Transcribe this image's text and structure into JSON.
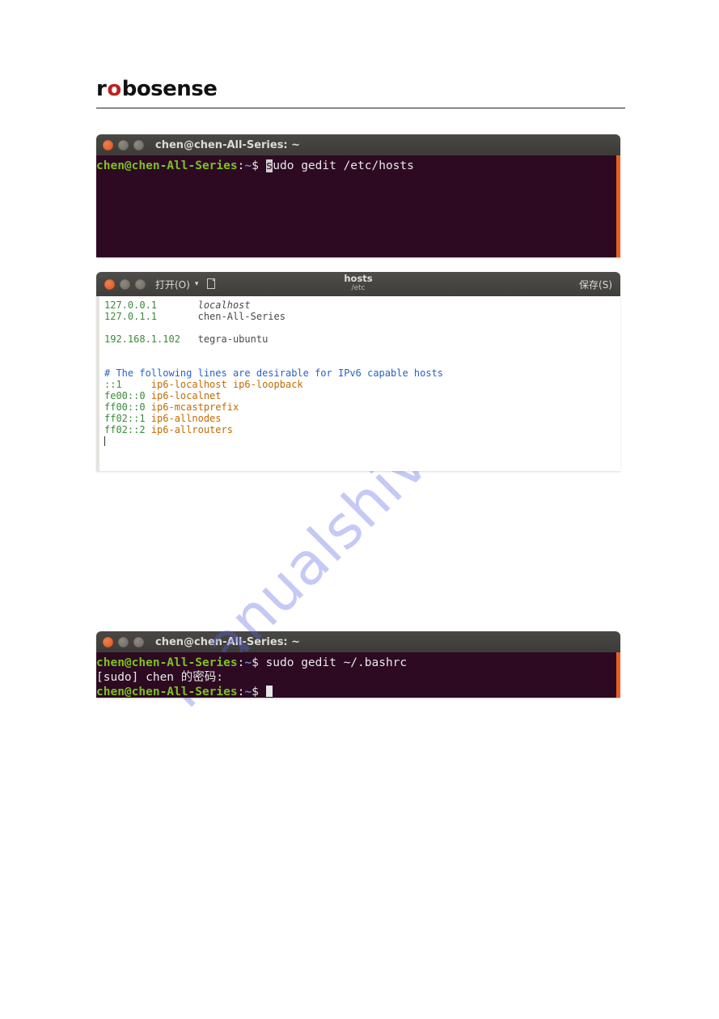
{
  "logo": {
    "text_pre": "r",
    "text_o1": "o",
    "text_rest": "bosense"
  },
  "watermark": "manualshive.com",
  "terminal1": {
    "title": "chen@chen-All-Series: ~",
    "prompt_userhost": "chen@chen-All-Series",
    "prompt_colon": ":",
    "prompt_path": "~",
    "prompt_dollar": "$ ",
    "cmd_hl": "s",
    "cmd_rest": "udo gedit /etc/hosts"
  },
  "gedit": {
    "open_label": "打开(O)",
    "save_label": "保存(S)",
    "filename": "hosts",
    "filepath": "/etc",
    "content": {
      "l1_ip": "127.0.0.1",
      "l1_pad": "       ",
      "l1_host": "localhost",
      "l2_ip": "127.0.1.1",
      "l2_pad": "       ",
      "l2_host": "chen-All-Series",
      "l3_ip": "192.168.1.102",
      "l3_pad": "   ",
      "l3_host": "tegra-ubuntu",
      "comment": "# The following lines are desirable for IPv6 capable hosts",
      "l5a": "::1     ",
      "l5b": "ip6-localhost",
      "l5c": " ",
      "l5d": "ip6-loopback",
      "l6a": "fe00::0 ",
      "l6b": "ip6-localnet",
      "l7a": "ff00::0 ",
      "l7b": "ip6-mcastprefix",
      "l8a": "ff02::1 ",
      "l8b": "ip6-allnodes",
      "l9a": "ff02::2 ",
      "l9b": "ip6-allrouters"
    }
  },
  "terminal3": {
    "title": "chen@chen-All-Series: ~",
    "line1": {
      "prompt_userhost": "chen@chen-All-Series",
      "prompt_colon": ":",
      "prompt_path": "~",
      "prompt_dollar": "$ ",
      "cmd": "sudo gedit ~/.bashrc"
    },
    "line2": "[sudo] chen 的密码:",
    "line3": {
      "prompt_userhost": "chen@chen-All-Series",
      "prompt_colon": ":",
      "prompt_path": "~",
      "prompt_dollar": "$ "
    }
  }
}
